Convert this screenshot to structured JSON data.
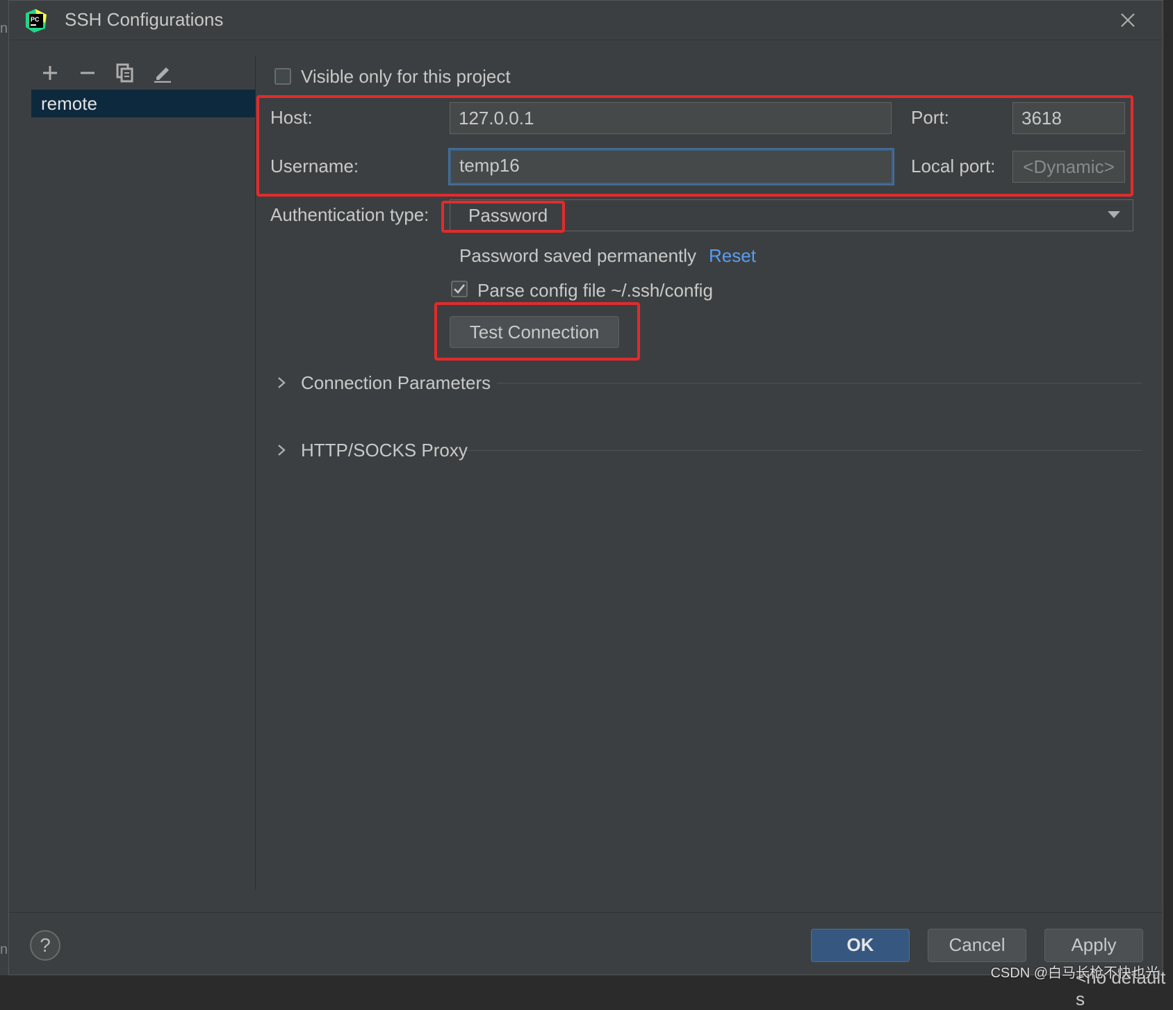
{
  "window": {
    "title": "SSH Configurations"
  },
  "toolbar": {
    "add": "add-icon",
    "remove": "remove-icon",
    "copy": "copy-icon",
    "edit": "edit-icon"
  },
  "configs": [
    {
      "label": "remote",
      "selected": true
    }
  ],
  "form": {
    "visible_only_label": "Visible only for this project",
    "visible_only_checked": false,
    "host_label": "Host:",
    "host_value": "127.0.0.1",
    "port_label": "Port:",
    "port_value": "3618",
    "username_label": "Username:",
    "username_value": "temp16",
    "local_port_label": "Local port:",
    "local_port_placeholder": "<Dynamic>",
    "auth_type_label": "Authentication type:",
    "auth_type_value": "Password",
    "password_saved_text": "Password saved permanently",
    "reset_link": "Reset",
    "parse_config_label": "Parse config file ~/.ssh/config",
    "parse_config_checked": true,
    "test_connection": "Test Connection"
  },
  "sections": [
    {
      "label": "Connection Parameters"
    },
    {
      "label": "HTTP/SOCKS Proxy"
    }
  ],
  "footer": {
    "help": "?",
    "ok": "OK",
    "cancel": "Cancel",
    "apply": "Apply"
  },
  "background": {
    "left_glyph_1": "n",
    "left_glyph_2": "n",
    "bottom_right_text": "<no default s"
  },
  "watermark": "CSDN @白马长枪不快也光",
  "colors": {
    "accent": "#365880",
    "link": "#589df6",
    "highlight_box": "#e32b2b",
    "selection": "#0d293e"
  }
}
